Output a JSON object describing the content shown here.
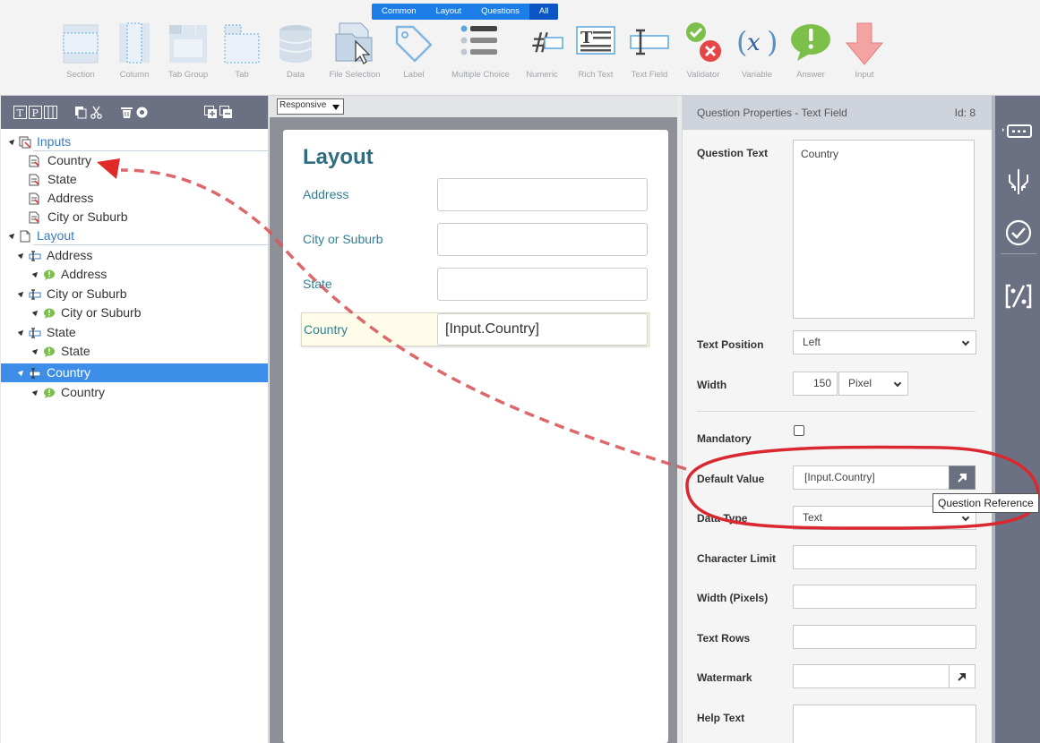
{
  "toolbar": {
    "filter_tabs": [
      "Common",
      "Layout",
      "Questions",
      "All"
    ],
    "active_filter": "All",
    "items": [
      {
        "label": "Section",
        "icon": "section-icon"
      },
      {
        "label": "Column",
        "icon": "column-icon"
      },
      {
        "label": "Tab Group",
        "icon": "tab-group-icon"
      },
      {
        "label": "Tab",
        "icon": "tab-icon"
      },
      {
        "label": "Data",
        "icon": "database-icon"
      },
      {
        "label": "File Selection",
        "icon": "file-selection-icon"
      },
      {
        "label": "Label",
        "icon": "tag-icon"
      },
      {
        "label": "Multiple Choice",
        "icon": "list-icon"
      },
      {
        "label": "Numeric",
        "icon": "hash-icon"
      },
      {
        "label": "Rich Text",
        "icon": "rich-text-icon"
      },
      {
        "label": "Text Field",
        "icon": "text-field-icon"
      },
      {
        "label": "Validator",
        "icon": "validator-icon"
      },
      {
        "label": "Variable",
        "icon": "variable-icon"
      },
      {
        "label": "Answer",
        "icon": "answer-icon"
      },
      {
        "label": "Input",
        "icon": "input-arrow-icon"
      }
    ]
  },
  "tree": {
    "toolbar_icons": [
      "text-icon",
      "p-icon",
      "columns-icon",
      "copy-icon",
      "cut-icon",
      "delete-icon",
      "eye-icon",
      "add-above-icon",
      "add-below-icon"
    ],
    "nodes": [
      {
        "label": "Inputs",
        "kind": "group",
        "level": 0
      },
      {
        "label": "Country",
        "kind": "input",
        "level": 1
      },
      {
        "label": "State",
        "kind": "input",
        "level": 1
      },
      {
        "label": "Address",
        "kind": "input",
        "level": 1
      },
      {
        "label": "City or Suburb",
        "kind": "input",
        "level": 1
      },
      {
        "label": "Layout",
        "kind": "group",
        "level": 0
      },
      {
        "label": "Address",
        "kind": "text-field",
        "level": 1
      },
      {
        "label": "Address",
        "kind": "answer",
        "level": 2
      },
      {
        "label": "City or Suburb",
        "kind": "text-field",
        "level": 1
      },
      {
        "label": "City or Suburb",
        "kind": "answer",
        "level": 2
      },
      {
        "label": "State",
        "kind": "text-field",
        "level": 1
      },
      {
        "label": "State",
        "kind": "answer",
        "level": 2
      },
      {
        "label": "Country",
        "kind": "text-field",
        "level": 1,
        "selected": true
      },
      {
        "label": "Country",
        "kind": "answer",
        "level": 2
      }
    ]
  },
  "canvas": {
    "view_mode": "Responsive",
    "form_title": "Layout",
    "fields": [
      {
        "label": "Address",
        "value": ""
      },
      {
        "label": "City or Suburb",
        "value": ""
      },
      {
        "label": "State",
        "value": ""
      },
      {
        "label": "Country",
        "value": "[Input.Country]",
        "highlighted": true
      }
    ]
  },
  "properties": {
    "header_title": "Question Properties - Text Field",
    "header_id": "Id: 8",
    "question_text_label": "Question Text",
    "question_text_value": "Country",
    "text_position_label": "Text Position",
    "text_position_value": "Left",
    "width_label": "Width",
    "width_value": "150",
    "width_unit": "Pixel",
    "mandatory_label": "Mandatory",
    "mandatory_checked": false,
    "default_value_label": "Default Value",
    "default_value_value": "[Input.Country]",
    "data_type_label": "Data Type",
    "data_type_value": "Text",
    "character_limit_label": "Character Limit",
    "width_pixels_label": "Width (Pixels)",
    "text_rows_label": "Text Rows",
    "watermark_label": "Watermark",
    "help_text_label": "Help Text"
  },
  "tooltip": "Question Reference",
  "rail": {
    "icons": [
      "text-field-mode-icon",
      "merge-icon",
      "check-circle-icon",
      "percent-bracket-icon"
    ]
  },
  "colors": {
    "accent_blue": "#3d8ee8",
    "annotation_red": "#d9282f",
    "form_label_teal": "#2f7f96",
    "rail_gray": "#6b7183"
  }
}
